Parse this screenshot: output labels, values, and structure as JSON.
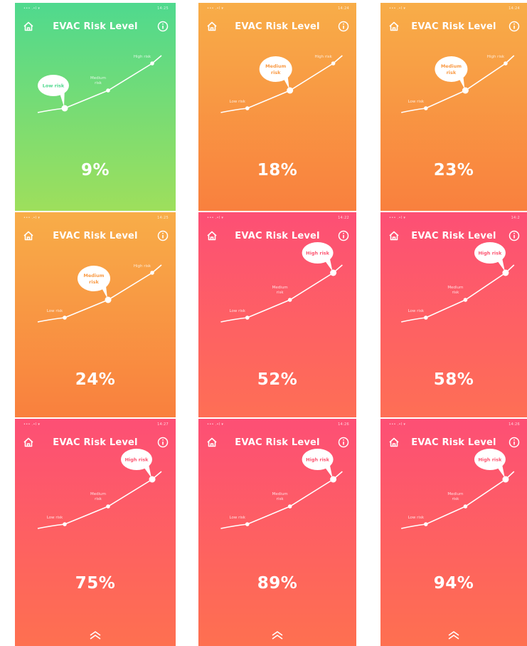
{
  "app": {
    "title": "EVAC Risk Level"
  },
  "labels": {
    "low": "Low risk",
    "medium_line1": "Medium",
    "medium_line2": "risk",
    "high": "High risk"
  },
  "screens": [
    {
      "percent": "9%",
      "risk_percent": 9,
      "highlight": "low",
      "gradient": [
        "#4fd98e",
        "#9edf5c"
      ],
      "status_right": "14:25"
    },
    {
      "percent": "18%",
      "risk_percent": 18,
      "highlight": "medium",
      "gradient": [
        "#f8ad48",
        "#f9803e"
      ],
      "status_right": "14:24"
    },
    {
      "percent": "23%",
      "risk_percent": 23,
      "highlight": "medium",
      "gradient": [
        "#f8ad48",
        "#f9803e"
      ],
      "status_right": "14:24"
    },
    {
      "percent": "24%",
      "risk_percent": 24,
      "highlight": "medium",
      "gradient": [
        "#f8ad48",
        "#f9803e"
      ],
      "status_right": "14:25"
    },
    {
      "percent": "52%",
      "risk_percent": 52,
      "highlight": "high",
      "gradient": [
        "#fd4f75",
        "#fe6f55"
      ],
      "status_right": "14:22"
    },
    {
      "percent": "58%",
      "risk_percent": 58,
      "highlight": "high",
      "gradient": [
        "#fd4f75",
        "#fe6f55"
      ],
      "status_right": "14:2"
    },
    {
      "percent": "75%",
      "risk_percent": 75,
      "highlight": "high",
      "gradient": [
        "#fd4f75",
        "#fe7050"
      ],
      "status_right": "14:27",
      "show_chevron": true
    },
    {
      "percent": "89%",
      "risk_percent": 89,
      "highlight": "high",
      "gradient": [
        "#fd4f75",
        "#fe7050"
      ],
      "status_right": "14:26",
      "show_chevron": true
    },
    {
      "percent": "94%",
      "risk_percent": 94,
      "highlight": "high",
      "gradient": [
        "#fd4f75",
        "#fe7050"
      ],
      "status_right": "14:26",
      "show_chevron": true
    }
  ],
  "icons": {
    "home": "home-icon",
    "info": "info-icon",
    "scroll_up": "chevron-up-icon"
  },
  "colors": {
    "text": "#ffffff",
    "low_label": "#4fd98e",
    "medium_label": "#f99a44",
    "high_label": "#fd5470"
  }
}
